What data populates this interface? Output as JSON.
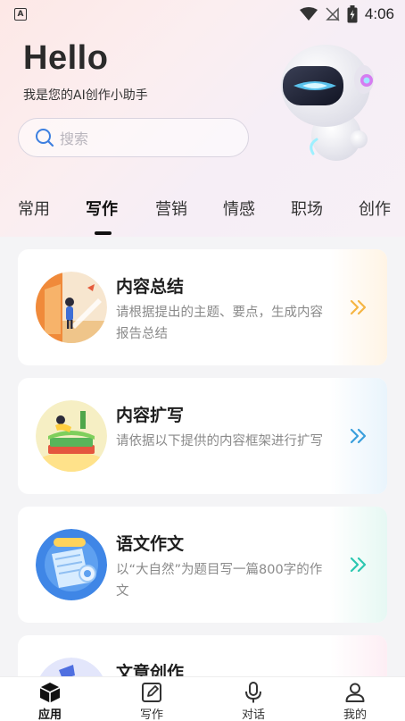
{
  "status_bar": {
    "app_badge": "A",
    "time": "4:06"
  },
  "header": {
    "greeting": "Hello",
    "subtitle": "我是您的AI创作小助手"
  },
  "search": {
    "placeholder": "搜索"
  },
  "tabs": [
    {
      "label": "常用"
    },
    {
      "label": "写作",
      "active": true
    },
    {
      "label": "营销"
    },
    {
      "label": "情感"
    },
    {
      "label": "职场"
    },
    {
      "label": "创作"
    }
  ],
  "cards": [
    {
      "title": "内容总结",
      "desc": "请根据提出的主题、要点，生成内容报告总结",
      "accent": "#f5b544",
      "icon": "girl-with-book-icon"
    },
    {
      "title": "内容扩写",
      "desc": "请依据以下提供的内容框架进行扩写",
      "accent": "#3a9fdc",
      "icon": "book-stack-icon"
    },
    {
      "title": "语文作文",
      "desc": "以“大自然”为题目写一篇800字的作文",
      "accent": "#2cc7b0",
      "icon": "chinese-essay-icon"
    },
    {
      "title": "文章创作",
      "desc": "",
      "accent": "#e98bb0",
      "icon": "lamp-icon"
    }
  ],
  "bottom_nav": [
    {
      "label": "应用",
      "icon": "cube-icon",
      "active": true
    },
    {
      "label": "写作",
      "icon": "edit-icon"
    },
    {
      "label": "对话",
      "icon": "microphone-icon"
    },
    {
      "label": "我的",
      "icon": "user-icon"
    }
  ]
}
